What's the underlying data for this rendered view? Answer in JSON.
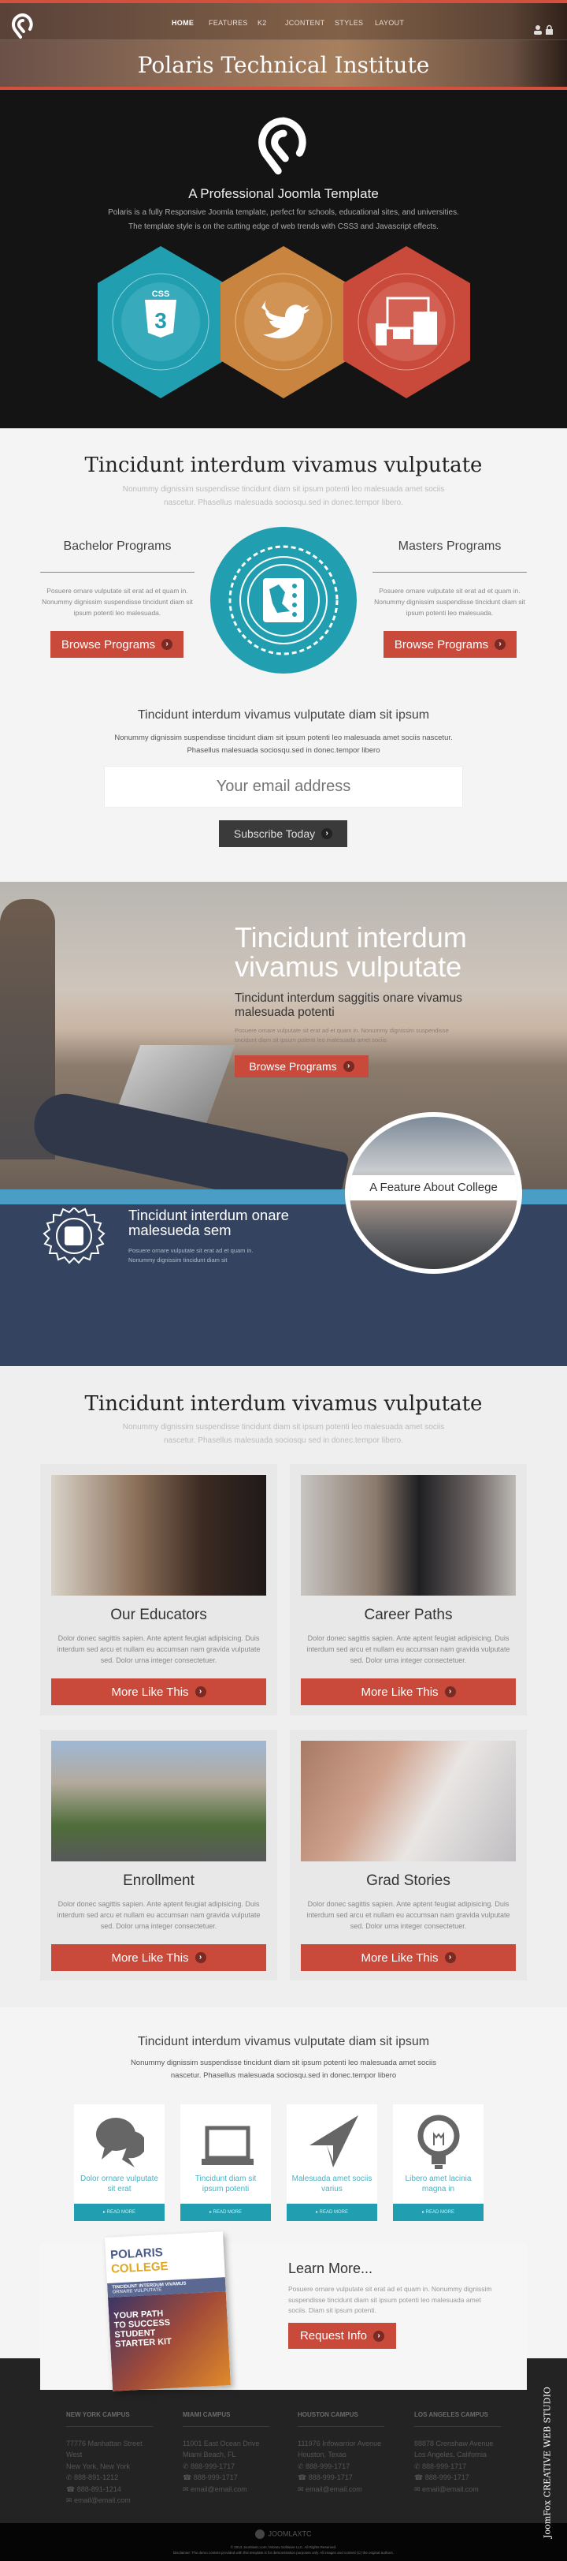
{
  "colors": {
    "accent": "#c9493a",
    "teal": "#219fb0",
    "orange": "#c98540",
    "navy": "#34435f",
    "band": "#4a9ec5"
  },
  "nav": {
    "items": [
      "HOME",
      "FEATURES",
      "K2",
      "JCONTENT",
      "STYLES",
      "LAYOUT"
    ],
    "active": "HOME",
    "icons": [
      "user-icon",
      "lock-icon"
    ]
  },
  "site_title": "Polaris Technical Institute",
  "intro": {
    "heading": "A Professional Joomla Template",
    "line1": "Polaris is a fully Responsive Joomla template, perfect for schools, educational sites, and universities.",
    "line2": "The template style is on the cutting edge of web trends with CSS3 and Javascript effects.",
    "hexagons": [
      "css3-icon",
      "twitter-icon",
      "responsive-devices-icon"
    ]
  },
  "programs": {
    "heading": "Tincidunt interdum vivamus vulputate",
    "sub": "Nonummy dignissim suspendisse tincidunt diam sit ipsum potenti leo malesuada amet sociis nascetur. Phasellus malesuada sociosqu.sed in donec.tempor libero.",
    "left": {
      "title": "Bachelor Programs",
      "text": "Posuere ornare vulputate sit erat ad et quam in. Nonummy dignissim suspendisse tincidunt diam sit ipsum potenti leo malesuada.",
      "button": "Browse Programs"
    },
    "right": {
      "title": "Masters Programs",
      "text": "Posuere ornare vulputate sit erat ad et quam in. Nonummy dignissim suspendisse tincidunt diam sit ipsum potenti leo malesuada.",
      "button": "Browse Programs"
    }
  },
  "subscribe": {
    "heading": "Tincidunt interdum vivamus vulputate diam sit ipsum",
    "text": "Nonummy dignissim suspendisse tincidunt diam sit ipsum potenti leo malesuada amet sociis nascetur. Phasellus malesuada sociosqu.sed in donec.tempor libero",
    "placeholder": "Your email address",
    "button": "Subscribe Today"
  },
  "hero": {
    "heading": "Tincidunt interdum vivamus vulputate",
    "subheading": "Tincidunt interdum saggitis onare vivamus malesuada potenti",
    "text": "Posuere ornare vulputate sit erat ad et quam in. Nonummy dignissim suspendisse tincidunt diam sit ipsum potenti leo malesuada amet sociis",
    "button": "Browse Programs",
    "feature_label": "A Feature About College"
  },
  "navy": {
    "heading": "Tincidunt interdum onare malesueda sem",
    "text": "Posuere ornare vulputate sit erat ad et quam in. Nonummy dignissim tincidunt diam sit"
  },
  "cards_section": {
    "heading": "Tincidunt interdum vivamus vulputate",
    "sub": "Nonummy dignissim suspendisse tincidunt diam sit ipsum potenti leo malesuada amet sociis nascetur. Phasellus malesuada sociosqu sed in donec.tempor libero.",
    "cards": [
      {
        "title": "Our Educators",
        "text": "Dolor donec sagittis sapien. Ante aptent feugiat adipisicing. Duis interdum sed arcu et nullam eu accumsan nam gravida vulputate sed. Dolor urna integer consectetuer.",
        "button": "More Like This"
      },
      {
        "title": "Career Paths",
        "text": "Dolor donec sagittis sapien. Ante aptent feugiat adipisicing. Duis interdum sed arcu et nullam eu accumsan nam gravida vulputate sed. Dolor urna integer consectetuer.",
        "button": "More Like This"
      },
      {
        "title": "Enrollment",
        "text": "Dolor donec sagittis sapien. Ante aptent feugiat adipisicing. Duis interdum sed arcu et nullam eu accumsan nam gravida vulputate sed. Dolor urna integer consectetuer.",
        "button": "More Like This"
      },
      {
        "title": "Grad Stories",
        "text": "Dolor donec sagittis sapien. Ante aptent feugiat adipisicing. Duis interdum sed arcu et nullam eu accumsan nam gravida vulputate sed. Dolor urna integer consectetuer.",
        "button": "More Like This"
      }
    ]
  },
  "features": {
    "heading": "Tincidunt interdum vivamus vulputate diam sit ipsum",
    "text": "Nonummy dignissim suspendisse tincidunt diam sit ipsum potenti leo malesuada amet sociis nascetur. Phasellus malesuada sociosqu.sed in donec.tempor libero",
    "items": [
      {
        "icon": "chat-bubbles-icon",
        "label": "Dolor ornare vulputate sit erat",
        "more": "READ MORE"
      },
      {
        "icon": "laptop-icon",
        "label": "Tincidunt diam sit ipsum potenti",
        "more": "READ MORE"
      },
      {
        "icon": "paper-plane-icon",
        "label": "Malesuada amet sociis varius",
        "more": "READ MORE"
      },
      {
        "icon": "lightbulb-icon",
        "label": "Libero amet lacinia magna in",
        "more": "READ MORE"
      }
    ]
  },
  "learn": {
    "heading": "Learn More...",
    "text": "Posuere ornare vulputate sit erat ad et quam in. Nonummy dignissim suspendisse tincidunt diam sit ipsum potenti leo malesuada amet sociis. Diam sit ipsum potenti.",
    "button": "Request Info",
    "brochure": {
      "brand1": "POLARIS",
      "brand2": "COLLEGE",
      "tag1": "TINCIDUNT INTERDUM VIVAMUS",
      "tag2": "ORNARE VULPUTATE",
      "kit": "YOUR PATH TO SUCCESS STUDENT STARTER KIT"
    }
  },
  "footer": {
    "campuses": [
      {
        "name": "NEW YORK CAMPUS",
        "addr1": "77776 Manhattan Street West",
        "addr2": "New York, New York",
        "phone": "888-891-1212",
        "fax": "888-891-1214",
        "email": "email@email.com"
      },
      {
        "name": "MIAMI CAMPUS",
        "addr1": "11001 East Ocean Drive",
        "addr2": "Miami Beach, FL",
        "phone": "888-999-1717",
        "fax": "888-999-1717",
        "email": "email@email.com"
      },
      {
        "name": "HOUSTON CAMPUS",
        "addr1": "111976 Infowarrior Avenue",
        "addr2": "Houston, Texas",
        "phone": "888-999-1717",
        "fax": "888-999-1717",
        "email": "email@email.com"
      },
      {
        "name": "LOS ANGELES CAMPUS",
        "addr1": "88878 Crenshaw Avenue",
        "addr2": "Los Angeles, California",
        "phone": "888-999-1717",
        "fax": "888-999-1717",
        "email": "email@email.com"
      }
    ],
    "brand": "JOOMLAXTC",
    "copyright": "© 2013 Joomlaxtc.com / Monev Software LLC. All Rights Reserved.",
    "disclaimer": "Disclaimer: The demo content provided with this template is for demonstration purposes only. All images and content (C) the original authors.",
    "badge": "JoomFox CREATIVE WEB STUDIO"
  }
}
